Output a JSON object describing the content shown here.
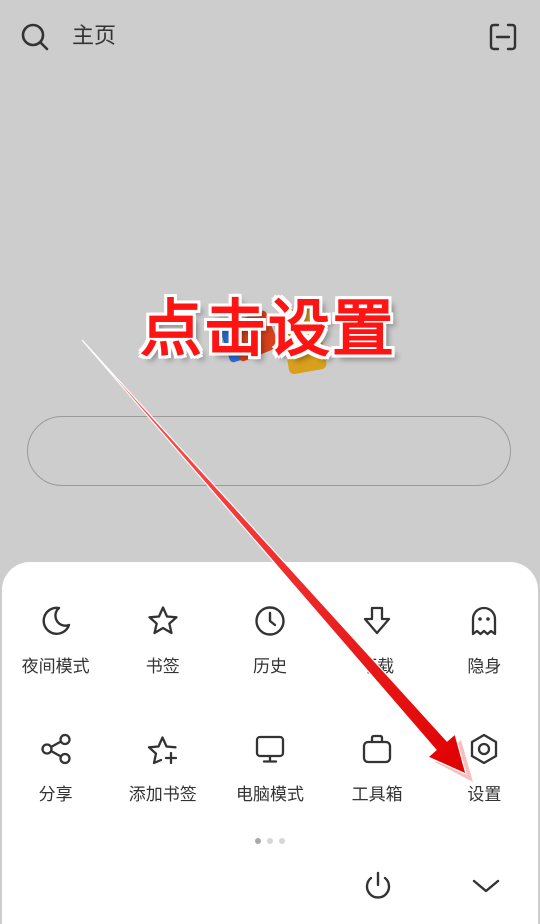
{
  "header": {
    "home_label": "主页",
    "search_icon": "search-icon",
    "scan_icon": "scan-icon"
  },
  "menu": {
    "rows": [
      [
        {
          "label": "夜间模式",
          "icon": "moon-icon"
        },
        {
          "label": "书签",
          "icon": "star-icon"
        },
        {
          "label": "历史",
          "icon": "clock-icon"
        },
        {
          "label": "下载",
          "icon": "download-icon"
        },
        {
          "label": "隐身",
          "icon": "ghost-icon"
        }
      ],
      [
        {
          "label": "分享",
          "icon": "share-icon"
        },
        {
          "label": "添加书签",
          "icon": "star-plus-icon"
        },
        {
          "label": "电脑模式",
          "icon": "monitor-icon"
        },
        {
          "label": "工具箱",
          "icon": "toolbox-icon"
        },
        {
          "label": "设置",
          "icon": "settings-icon"
        }
      ]
    ],
    "page_count": 3,
    "active_page": 1,
    "bottom_icons": [
      "power-icon",
      "chevron-down-icon"
    ]
  },
  "annotation": {
    "text": "点击设置",
    "color": "#ff1414"
  },
  "colors": {
    "background": "#cdcdcd",
    "sheet": "#ffffff",
    "text": "#333333"
  }
}
